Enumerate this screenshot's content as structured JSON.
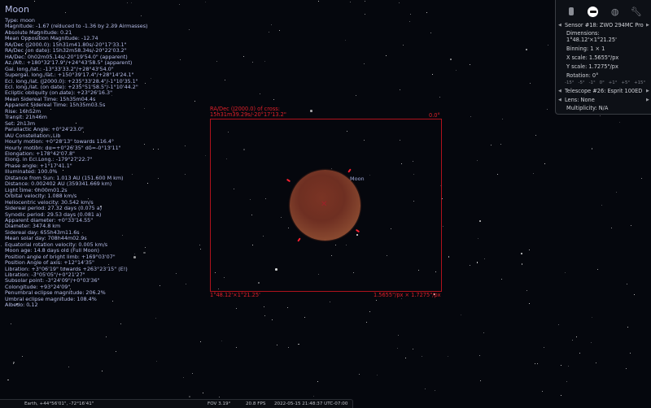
{
  "info": {
    "title": "Moon",
    "lines": [
      "Type: moon",
      "Magnitude: -1.67 (reduced to -1.36 by 2.39 Airmasses)",
      "Absolute Magnitude: 0.21",
      "Mean Opposition Magnitude: -12.74",
      "RA/Dec (J2000.0): 15h31m41.80s/-20°17'33.1\"",
      "RA/Dec (on date): 15h32m58.34s/-20°22'03.2\"",
      "HA/Dec: 0h02m05.14s/-20°19'54.0\" (apparent)",
      "Az./Alt.: +180°32'17.9\"/+24°43'58.5\" (apparent)",
      "Gal. long./lat.: -13°33'33.2\"/+28°43'54.0\"",
      "Supergal. long./lat.: +150°39'17.4\"/+28°14'24.1\"",
      "Ecl. long./lat. (J2000.0): +235°33'28.4\"/-1°10'35.1\"",
      "Ecl. long./lat. (on date): +235°51'58.5\"/-1°10'44.2\"",
      "Ecliptic obliquity (on date): +23°26'16.3\"",
      "Mean Sidereal Time: 15h35m04.4s",
      "Apparent Sidereal Time: 15h35m03.5s",
      "Rise: 16h52m",
      "Transit: 21h46m",
      "Set: 2h13m",
      "Parallactic Angle: +0°24'23.0\"",
      "IAU Constellation: Lib",
      "Hourly motion: +0°28'13\" towards 116.4°",
      "Hourly motion: dα=+0°26'35\" dδ=-0°13'11\"",
      "Elongation: +178°42'07.8\"",
      "Elong. in Ecl.Long.: -179°27'22.7\"",
      "Phase angle: +1°17'41.1\"",
      "Illuminated: 100.0%",
      "Distance from Sun: 1.013 AU (151.600 M km)",
      "Distance: 0.002402 AU (359341.669 km)",
      "Light time: 0h00m01.2s",
      "Orbital velocity: 1.088 km/s",
      "Heliocentric velocity: 30.542 km/s",
      "Sidereal period: 27.32 days (0.075 a)",
      "Synodic period: 29.53 days (0.081 a)",
      "Apparent diameter: +0°33'14.55\"",
      "Diameter: 3474.8 km",
      "Sidereal day: 655h43m11.6s",
      "Mean solar day: 708h44m02.9s",
      "Equatorial rotation velocity: 0.005 km/s",
      "Moon age: 14.8 days old (Full Moon)",
      "Position angle of bright limb: +169°03'07\"",
      "Position Angle of axis: +12°14'35\"",
      "Libration: +3°06'19\" towards +263°23'15\" (E!)",
      "Libration: -3°05'05\"/+0°21'27\"",
      "Subsolar point: -3°24'09\"/+0°03'36\"",
      "Colongitude: +93°24'09\"",
      "Penumbral eclipse magnitude: 206.2%",
      "Umbral eclipse magnitude: 108.4%",
      "Albedo: 0.12"
    ]
  },
  "ocular": {
    "cross_label": "RA/Dec (J2000.0) of cross:",
    "cross_value": "15h31m39.29s/-20°17'13.2\"",
    "rotation_label": "0.0°",
    "fov_label": "1°48.12'×1°21.25'",
    "scale_label": "1.5655\"/px × 1.7275\"/px",
    "object_label": "Moon",
    "color": "#e0202a"
  },
  "panel": {
    "icons": [
      "telescope-icon",
      "sensor-icon",
      "lens-icon",
      "wrench-icon"
    ],
    "active_icon": "sensor-icon",
    "sensor": "Sensor #18: ZWO 294MC  Pro",
    "dimensions_label": "Dimensions:",
    "dimensions": "1°48.12'×1°21.25'",
    "binning": "Binning: 1 × 1",
    "x_scale": "X scale: 1.5655\"/px",
    "y_scale": "Y scale: 1.7275\"/px",
    "rotation": "Rotation: 0°",
    "rotation_steps": [
      "-15°",
      "-5°",
      "-1°",
      "0°",
      "+1°",
      "+5°",
      "+15°"
    ],
    "telescope": "Telescope #26: Esprit 100ED",
    "lens": "Lens: None",
    "multiplicity": "Multiplicity: N/A"
  },
  "bottombar": {
    "location": "Earth, +44°56'01\", -72°16'41\"",
    "fov": "FOV 3.19°",
    "fps": "20.8 FPS",
    "datetime": "2022-05-15 21:48:37 UTC-07:00"
  }
}
